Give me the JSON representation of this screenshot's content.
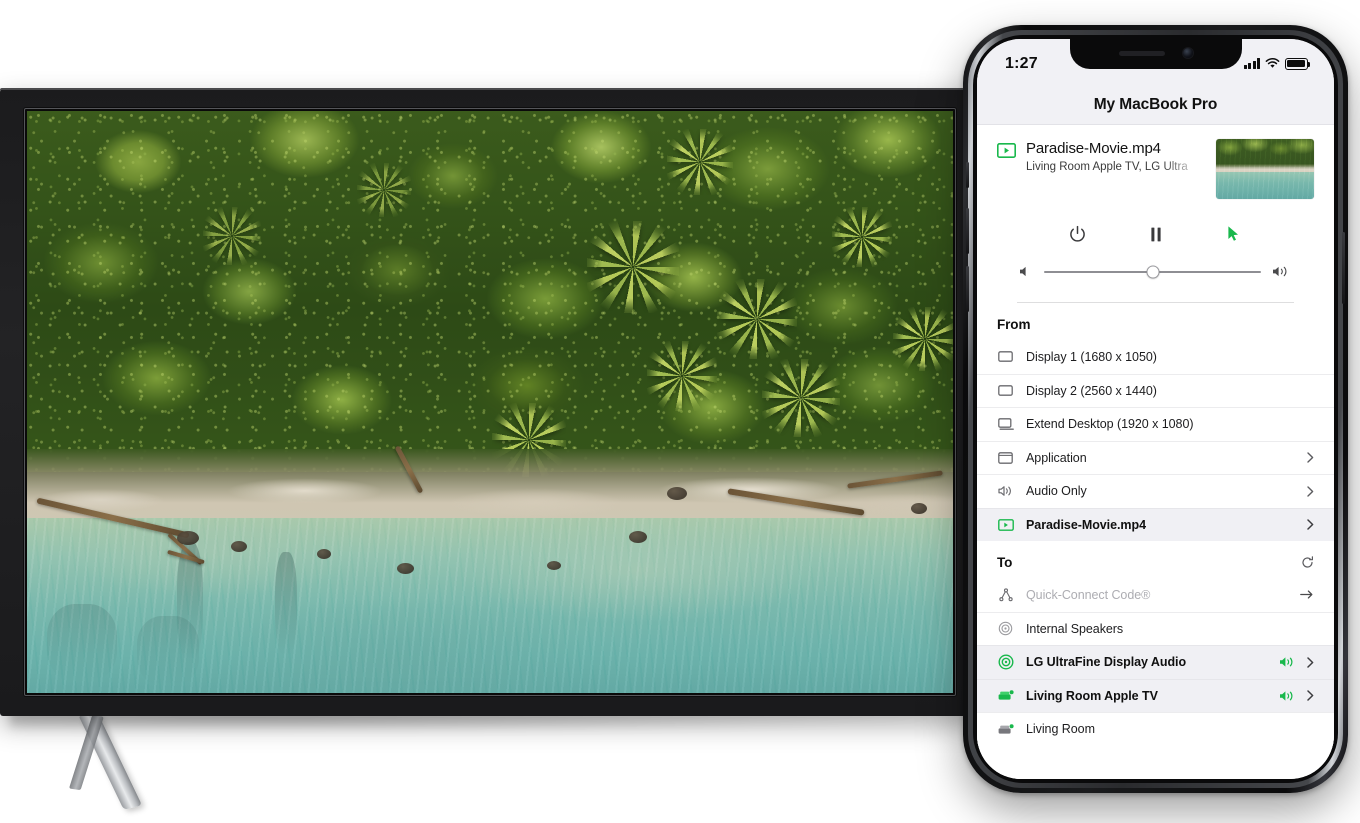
{
  "phone": {
    "status_bar": {
      "time": "1:27",
      "cellular_icon": "signal-bars-icon",
      "wifi_icon": "wifi-icon",
      "battery_icon": "battery-icon"
    },
    "nav_title": "My MacBook Pro",
    "now_playing": {
      "source_icon": "video-file-icon",
      "title": "Paradise-Movie.mp4",
      "subtitle": "Living Room Apple TV, LG Ultra",
      "thumbnail_alt": "aerial-beach-thumbnail"
    },
    "transport": {
      "power_label": "Power",
      "pause_label": "Pause",
      "pointer_label": "Remote Pointer",
      "power_icon": "power-icon",
      "pause_icon": "pause-icon",
      "pointer_icon": "cursor-arrow-icon"
    },
    "volume": {
      "min_icon": "speaker-low-icon",
      "max_icon": "speaker-high-icon",
      "value_percent": 50
    },
    "from": {
      "heading": "From",
      "items": [
        {
          "label": "Display 1 (1680 x 1050)",
          "icon": "display-icon",
          "chevron": false,
          "selected": false
        },
        {
          "label": "Display 2 (2560 x 1440)",
          "icon": "display-icon",
          "chevron": false,
          "selected": false
        },
        {
          "label": "Extend Desktop (1920 x 1080)",
          "icon": "extend-desktop-icon",
          "chevron": false,
          "selected": false
        },
        {
          "label": "Application",
          "icon": "window-icon",
          "chevron": true,
          "selected": false
        },
        {
          "label": "Audio Only",
          "icon": "speaker-icon",
          "chevron": true,
          "selected": false
        },
        {
          "label": "Paradise-Movie.mp4",
          "icon": "video-file-icon",
          "chevron": true,
          "selected": true
        }
      ]
    },
    "to": {
      "heading": "To",
      "refresh_icon": "refresh-icon",
      "items": [
        {
          "label": "Quick-Connect Code®",
          "icon": "share-network-icon",
          "chevron": false,
          "selected": false,
          "muted": true,
          "action_icon": "arrow-right-icon",
          "volume_icon": false
        },
        {
          "label": "Internal Speakers",
          "icon": "speaker-circles-icon",
          "chevron": false,
          "selected": false,
          "muted": false,
          "volume_icon": false
        },
        {
          "label": "LG UltraFine Display Audio",
          "icon": "speaker-circles-icon",
          "chevron": true,
          "selected": true,
          "muted": false,
          "volume_icon": true
        },
        {
          "label": "Living Room Apple TV",
          "icon": "apple-tv-icon",
          "chevron": true,
          "selected": true,
          "muted": false,
          "volume_icon": true
        },
        {
          "label": "Living Room",
          "icon": "apple-tv-icon",
          "chevron": false,
          "selected": false,
          "muted": false,
          "volume_icon": false
        }
      ]
    }
  },
  "tv": {
    "screen_content_alt": "aerial-view-of-tropical-jungle-and-turquoise-beach"
  },
  "colors": {
    "accent_green": "#19b84c",
    "selected_row_bg": "#f0f0f4",
    "chrome_bg": "#f1f1f5",
    "text_primary": "#111111",
    "text_muted": "#adadb2",
    "divider": "#ececee"
  }
}
